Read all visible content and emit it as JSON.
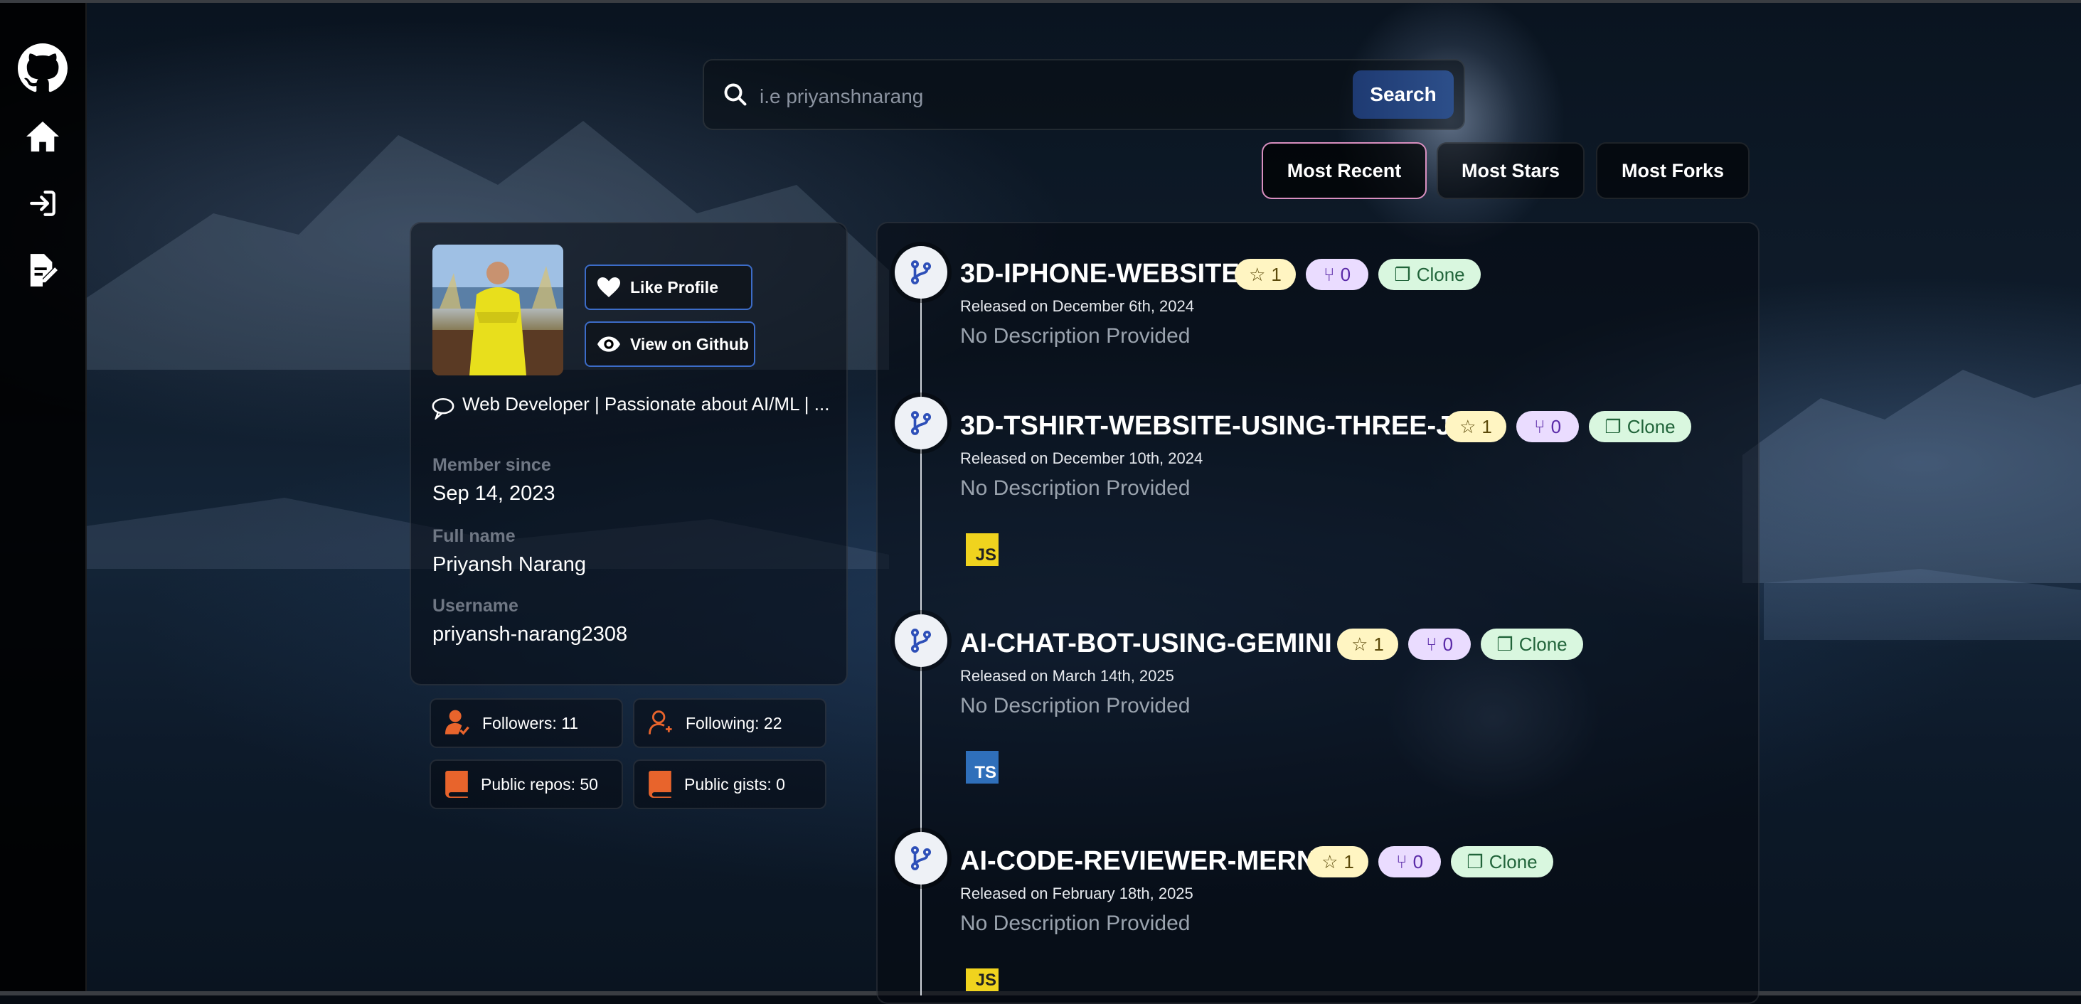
{
  "sidebar": {
    "items": [
      {
        "icon": "github-icon"
      },
      {
        "icon": "home-icon"
      },
      {
        "icon": "login-icon"
      },
      {
        "icon": "signup-icon"
      }
    ]
  },
  "search": {
    "placeholder": "i.e priyanshnarang",
    "button_label": "Search"
  },
  "sort_tabs": [
    {
      "label": "Most Recent",
      "active": true
    },
    {
      "label": "Most Stars",
      "active": false
    },
    {
      "label": "Most Forks",
      "active": false
    }
  ],
  "profile": {
    "like_label": "Like Profile",
    "github_label": "View on Github",
    "bio": "Web Developer | Passionate about AI/ML | ...",
    "member_since_label": "Member since",
    "member_since": "Sep 14, 2023",
    "full_name_label": "Full name",
    "full_name": "Priyansh Narang",
    "username_label": "Username",
    "username": "priyansh-narang2308"
  },
  "stats": {
    "followers": "Followers: 11",
    "following": "Following: 22",
    "public_repos": "Public repos: 50",
    "public_gists": "Public gists: 0"
  },
  "repos": [
    {
      "name": "3D-IPHONE-WEBSITE",
      "stars": "1",
      "forks": "0",
      "clone_label": "Clone",
      "released": "Released on December 6th, 2024",
      "description": "No Description Provided",
      "language": ""
    },
    {
      "name": "3D-TSHIRT-WEBSITE-USING-THREE-JS",
      "stars": "1",
      "forks": "0",
      "clone_label": "Clone",
      "released": "Released on December 10th, 2024",
      "description": "No Description Provided",
      "language": "JS"
    },
    {
      "name": "AI-CHAT-BOT-USING-GEMINI",
      "stars": "1",
      "forks": "0",
      "clone_label": "Clone",
      "released": "Released on March 14th, 2025",
      "description": "No Description Provided",
      "language": "TS"
    },
    {
      "name": "AI-CODE-REVIEWER-MERN",
      "stars": "1",
      "forks": "0",
      "clone_label": "Clone",
      "released": "Released on February 18th, 2025",
      "description": "No Description Provided",
      "language": "JS"
    }
  ],
  "colors": {
    "accent": "#2d4f8a",
    "active_tab_border": "#d98fc0",
    "stat_icon": "#e8642c",
    "star_badge": "#fff5c2",
    "fork_badge": "#eadcff",
    "clone_badge": "#d9f7df"
  }
}
